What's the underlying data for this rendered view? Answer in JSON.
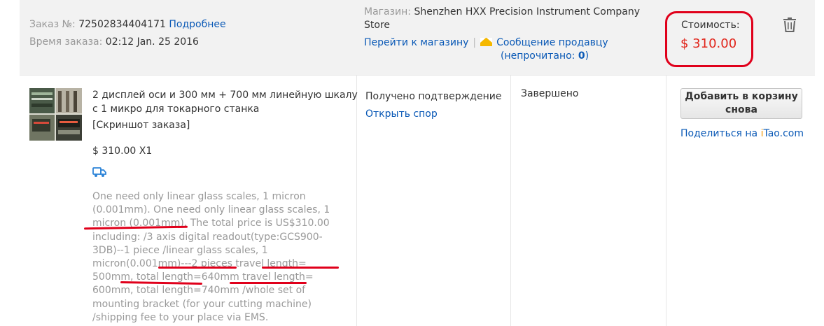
{
  "order": {
    "number_label": "Заказ №:",
    "number": "72502834404171",
    "details_link": "Подробнее",
    "time_label": "Время заказа:",
    "time": "02:12 Jan. 25 2016"
  },
  "store": {
    "label": "Магазин:",
    "name": "Shenzhen HXX Precision Instrument Company Store",
    "go_to_store": "Перейти к магазину",
    "message_seller": "Сообщение продавцу",
    "unread_prefix": "(непрочитано: ",
    "unread_count": "0",
    "unread_suffix": ")"
  },
  "cost": {
    "label": "Стоимость:",
    "value": "$ 310.00"
  },
  "product": {
    "title": "2 дисплей оси и 300 мм + 700 мм линейную шкалу с 1 микро для токарного станка",
    "snapshot": "[Скриншот заказа]",
    "price_qty": "$ 310.00 X1",
    "description": "One need only linear glass scales, 1 micron (0.001mm). One need only linear glass scales, 1 micron (0.001mm). The total price is US$310.00 including: /3 axis digital readout(type:GCS900-3DB)--1 piece /linear glass scales, 1 micron(0.001mm)---2 pieces travel length= 500mm, total length=640mm travel length= 600mm, total length=740mm /whole set of mounting bracket (for your cutting machine) /shipping fee to your place via EMS."
  },
  "status": {
    "confirmation": "Получено подтверждение",
    "open_dispute": "Открыть спор",
    "order_status": "Завершено"
  },
  "actions": {
    "add_to_cart_again": "Добавить в корзину снова",
    "share_prefix": "Поделиться на ",
    "share_brand_i": "i",
    "share_brand_rest": "Tao.com"
  },
  "colors": {
    "accent_link": "#0a59b6",
    "price_red": "#e1251b",
    "annotation_red": "#e0001b",
    "header_bg": "#f2f2f2"
  },
  "icons": [
    "trash-icon",
    "envelope-icon",
    "truck-icon",
    "product-thumbnail"
  ]
}
